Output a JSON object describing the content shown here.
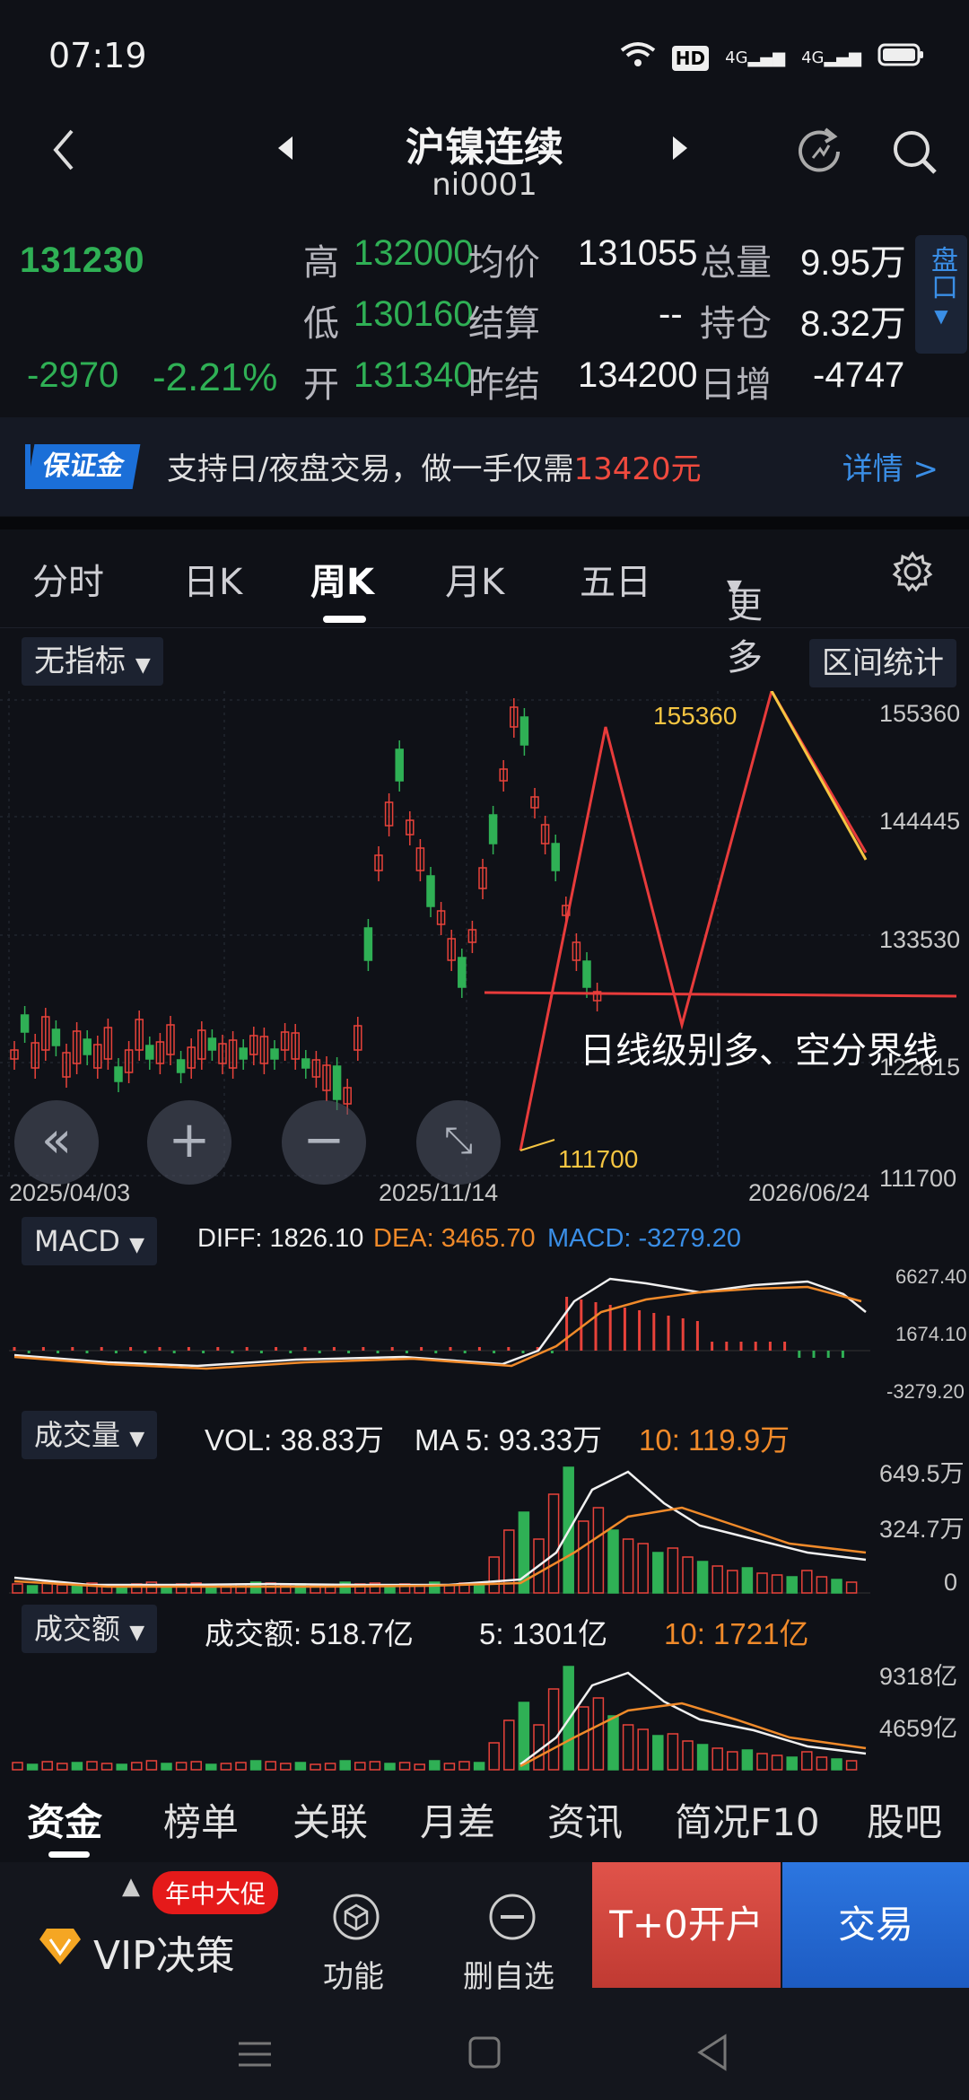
{
  "status_bar": {
    "time": "07:19",
    "hd": "HD",
    "net1": "4G",
    "net2": "4G"
  },
  "header": {
    "title": "沪镍连续",
    "code": "ni0001"
  },
  "quote": {
    "price": "131230",
    "change": "-2970",
    "change_pct": "-2.21%",
    "high_label": "高",
    "high": "132000",
    "avg_label": "均价",
    "avg": "131055",
    "vol_label": "总量",
    "vol": "9.95万",
    "low_label": "低",
    "low": "130160",
    "settle_label": "结算",
    "settle": "--",
    "oi_label": "持仓",
    "oi": "8.32万",
    "open_label": "开",
    "open": "131340",
    "prev_label": "昨结",
    "prev": "134200",
    "daily_label": "日增",
    "daily": "-4747",
    "pankou": "盘口"
  },
  "banner": {
    "tag": "保证金",
    "text": "支持日/夜盘交易，做一手仅需",
    "amount": "13420元",
    "detail": "详情 >"
  },
  "tabs": [
    "分时",
    "日K",
    "周K",
    "月K",
    "五日",
    "更多"
  ],
  "indicator": {
    "label": "无指标",
    "range_stats": "区间统计"
  },
  "main_chart": {
    "y_ticks": [
      "155360",
      "144445",
      "133530",
      "122615",
      "111700"
    ],
    "dates": [
      "2025/04/03",
      "2025/11/14",
      "2026/06/24"
    ],
    "high_label": "155360",
    "low_label": "111700",
    "annotation": "日线级别多、空分界线"
  },
  "macd": {
    "label": "MACD",
    "diff": "DIFF: 1826.10",
    "dea": "DEA: 3465.70",
    "macd": "MACD: -3279.20",
    "ticks": [
      "6627.40",
      "1674.10",
      "-3279.20"
    ]
  },
  "volume": {
    "label": "成交量",
    "vol": "VOL: 38.83万",
    "ma5": "MA 5: 93.33万",
    "ma10": "10: 119.9万",
    "ticks": [
      "649.5万",
      "324.7万",
      "0"
    ]
  },
  "amount": {
    "label": "成交额",
    "amt": "成交额: 518.7亿",
    "ma5": "5: 1301亿",
    "ma10": "10: 1721亿",
    "ticks": [
      "9318亿",
      "4659亿"
    ]
  },
  "bottom_tabs": [
    "资金",
    "榜单",
    "关联",
    "月差",
    "资讯",
    "简况F10",
    "股吧"
  ],
  "bottom_bar": {
    "promo": "年中大促",
    "vip": "VIP决策",
    "func": "功能",
    "remove": "删自选",
    "open_account": "T+0开户",
    "trade": "交易"
  },
  "colors": {
    "up": "#e8423a",
    "down": "#2fb055",
    "accent": "#3a8ee6",
    "orange": "#f08a2a",
    "yellow": "#f5c542"
  }
}
